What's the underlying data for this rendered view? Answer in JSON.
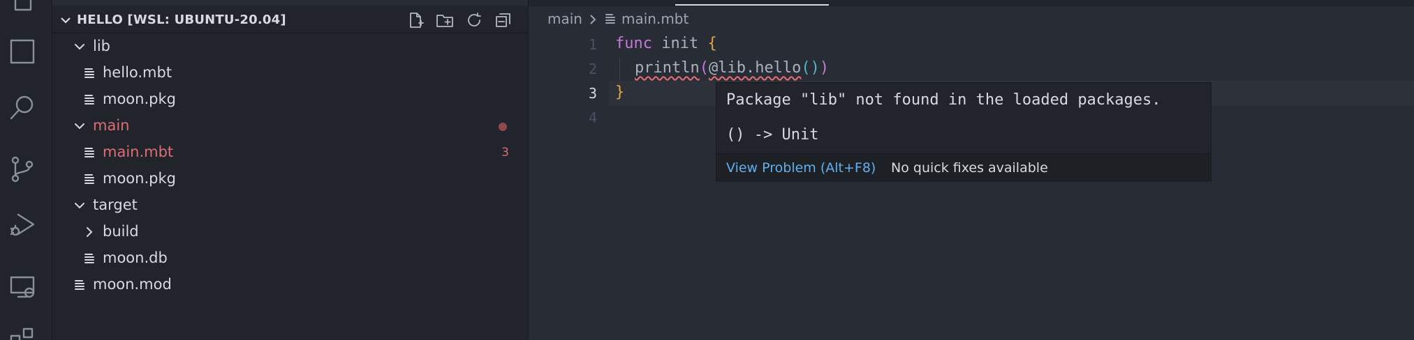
{
  "explorer": {
    "title": "HELLO [WSL: UBUNTU-20.04]",
    "items": [
      {
        "label": "lib",
        "kind": "folder",
        "expanded": true,
        "depth": 1
      },
      {
        "label": "hello.mbt",
        "kind": "file",
        "depth": 2
      },
      {
        "label": "moon.pkg",
        "kind": "file",
        "depth": 2
      },
      {
        "label": "main",
        "kind": "folder",
        "expanded": true,
        "depth": 1,
        "error": true
      },
      {
        "label": "main.mbt",
        "kind": "file",
        "depth": 2,
        "error": true,
        "badge": "3"
      },
      {
        "label": "moon.pkg",
        "kind": "file",
        "depth": 2
      },
      {
        "label": "target",
        "kind": "folder",
        "expanded": true,
        "depth": 1
      },
      {
        "label": "build",
        "kind": "folder",
        "expanded": false,
        "depth": 2
      },
      {
        "label": "moon.db",
        "kind": "file",
        "depth": 2
      },
      {
        "label": "moon.mod",
        "kind": "file",
        "depth": 1
      }
    ]
  },
  "breadcrumb": {
    "folder": "main",
    "file": "main.mbt"
  },
  "editor": {
    "line_numbers": [
      "1",
      "2",
      "3",
      "4"
    ],
    "active_line": "3",
    "code": {
      "l1_kw": "func",
      "l1_name": " init ",
      "l1_brace": "{",
      "l2_fn": "println",
      "l2_open": "(",
      "l2_call": "@lib.hello",
      "l2_inner": "()",
      "l2_close": ")",
      "l3_brace": "}"
    }
  },
  "hover": {
    "message": "Package \"lib\" not found in the loaded packages.",
    "signature": "() -> Unit",
    "view_problem": "View Problem (Alt+F8)",
    "no_fixes": "No quick fixes available"
  },
  "colors": {
    "error": "#e06c75",
    "link": "#61afef",
    "keyword": "#c678dd",
    "brace": "#e5a446"
  }
}
